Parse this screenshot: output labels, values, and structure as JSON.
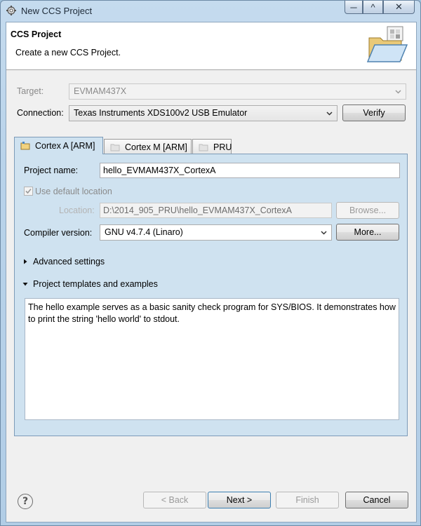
{
  "window": {
    "title": "New CCS Project",
    "caption_buttons": {
      "minimize": "─",
      "maximize": "^",
      "close": "✕"
    }
  },
  "header": {
    "title": "CCS Project",
    "description": "Create a new CCS Project.",
    "icon": "folder-wizard-icon"
  },
  "target": {
    "label": "Target:",
    "value": "EVMAM437X",
    "enabled": false
  },
  "connection": {
    "label": "Connection:",
    "value": "Texas Instruments XDS100v2 USB Emulator"
  },
  "buttons": {
    "verify": "Verify",
    "browse": "Browse...",
    "more": "More...",
    "back": "< Back",
    "next": "Next >",
    "finish": "Finish",
    "cancel": "Cancel",
    "help": "?"
  },
  "tabs": [
    {
      "label": "Cortex A [ARM]",
      "active": true
    },
    {
      "label": "Cortex M [ARM]",
      "active": false
    },
    {
      "label": "PRU",
      "active": false
    }
  ],
  "project": {
    "name_label": "Project name:",
    "name_value": "hello_EVMAM437X_CortexA",
    "use_default_label": "Use default location",
    "use_default_checked": true,
    "location_label": "Location:",
    "location_value": "D:\\2014_905_PRU\\hello_EVMAM437X_CortexA",
    "compiler_label": "Compiler version:",
    "compiler_value": "GNU v4.7.4 (Linaro)"
  },
  "sections": {
    "advanced": {
      "label": "Advanced settings",
      "expanded": false
    },
    "templates": {
      "label": "Project templates and examples",
      "expanded": true
    }
  },
  "template_description": "The hello example serves as a basic sanity check program for SYS/BIOS. It demonstrates how to print the string 'hello world' to stdout.",
  "colors": {
    "tab_panel": "#cfe2f0",
    "window_frame": "#b9d3ea",
    "dialog_bg": "#f0f0f0"
  }
}
